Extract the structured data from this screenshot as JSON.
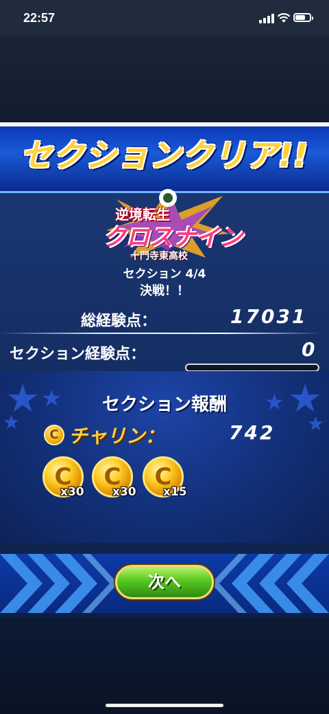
{
  "status_bar": {
    "time": "22:57"
  },
  "header": {
    "title": "セクションクリア!!"
  },
  "event_logo": {
    "line1": "逆境転生",
    "line2": "クロスナイン",
    "school": "十門寺東高校"
  },
  "section": {
    "progress": "セクション 4/4",
    "name": "決戦！！"
  },
  "stats": {
    "total_exp_label": "総経験点：",
    "total_exp_value": "17031",
    "section_exp_label": "セクション経験点：",
    "section_exp_value": "0"
  },
  "rewards": {
    "title": "セクション報酬",
    "currency_label": "チャリン：",
    "currency_value": "742",
    "coin_symbol": "C",
    "coins": [
      {
        "qty": "x30"
      },
      {
        "qty": "x30"
      },
      {
        "qty": "x15"
      }
    ]
  },
  "next_button": {
    "label": "次へ"
  },
  "colors": {
    "title_gold": "#ffd23a",
    "panel_blue": "#163066",
    "button_green": "#58c820"
  }
}
